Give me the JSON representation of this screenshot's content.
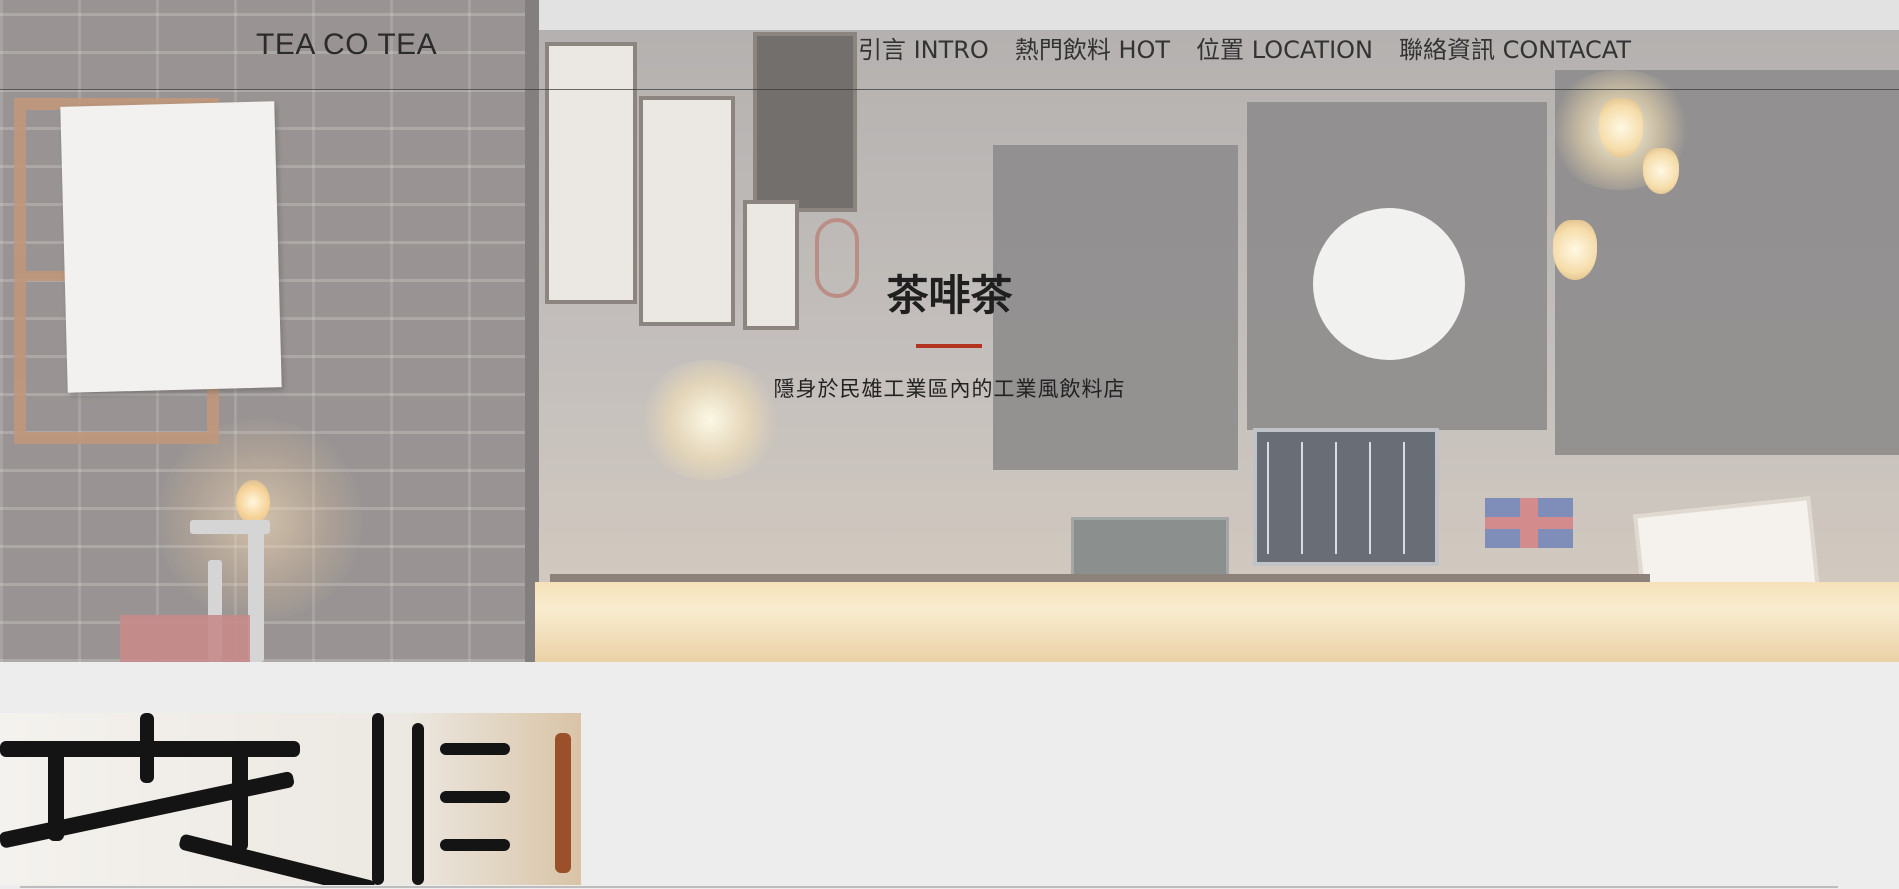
{
  "header": {
    "brand": "TEA CO TEA",
    "nav": [
      {
        "label": "引言 INTRO"
      },
      {
        "label": "熱門飲料 HOT"
      },
      {
        "label": "位置 LOCATION"
      },
      {
        "label": "聯絡資訊 CONTACAT"
      }
    ]
  },
  "hero": {
    "title": "茶啡茶",
    "subtitle": "隱身於民雄工業區內的工業風飲料店",
    "accent_color": "#b2341e"
  },
  "icons": {
    "hero_image": "shop-interior-photo",
    "thumbnail": "shop-logo-closeup-image"
  }
}
